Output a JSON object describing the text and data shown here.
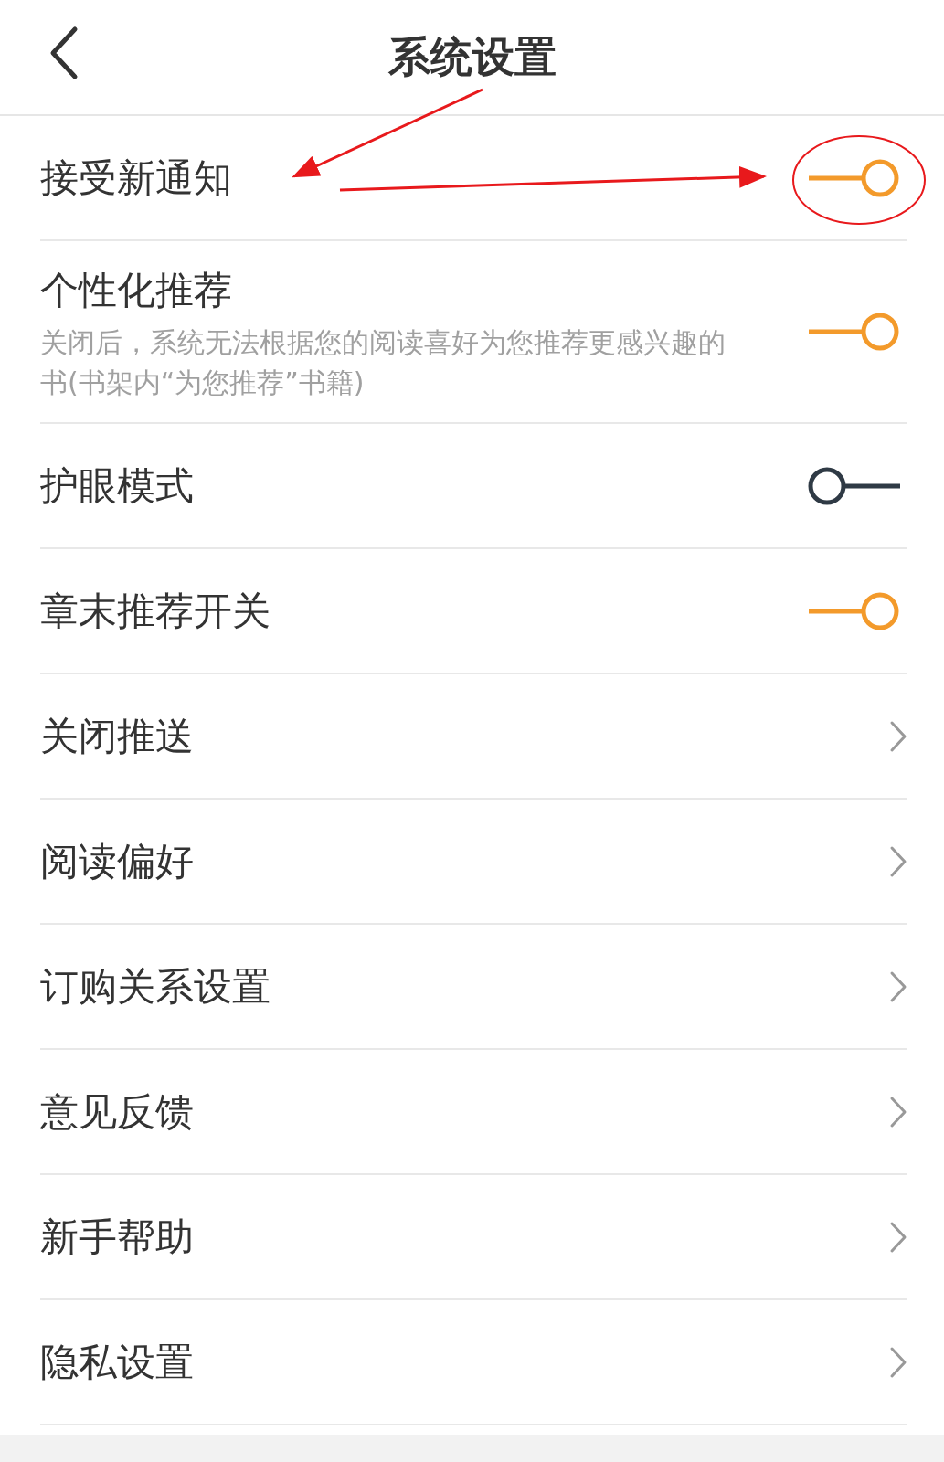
{
  "header": {
    "title": "系统设置"
  },
  "items": [
    {
      "kind": "toggle",
      "label": "接受新通知",
      "on": true
    },
    {
      "kind": "toggle",
      "label": "个性化推荐",
      "description": "关闭后，系统无法根据您的阅读喜好为您推荐更感兴趣的书(书架内“为您推荐”书籍)",
      "on": true
    },
    {
      "kind": "toggle",
      "label": "护眼模式",
      "on": false
    },
    {
      "kind": "toggle",
      "label": "章末推荐开关",
      "on": true
    },
    {
      "kind": "link",
      "label": "关闭推送"
    },
    {
      "kind": "link",
      "label": "阅读偏好"
    },
    {
      "kind": "link",
      "label": "订购关系设置"
    },
    {
      "kind": "link",
      "label": "意见反馈"
    },
    {
      "kind": "link",
      "label": "新手帮助"
    },
    {
      "kind": "link",
      "label": "隐私设置"
    }
  ]
}
